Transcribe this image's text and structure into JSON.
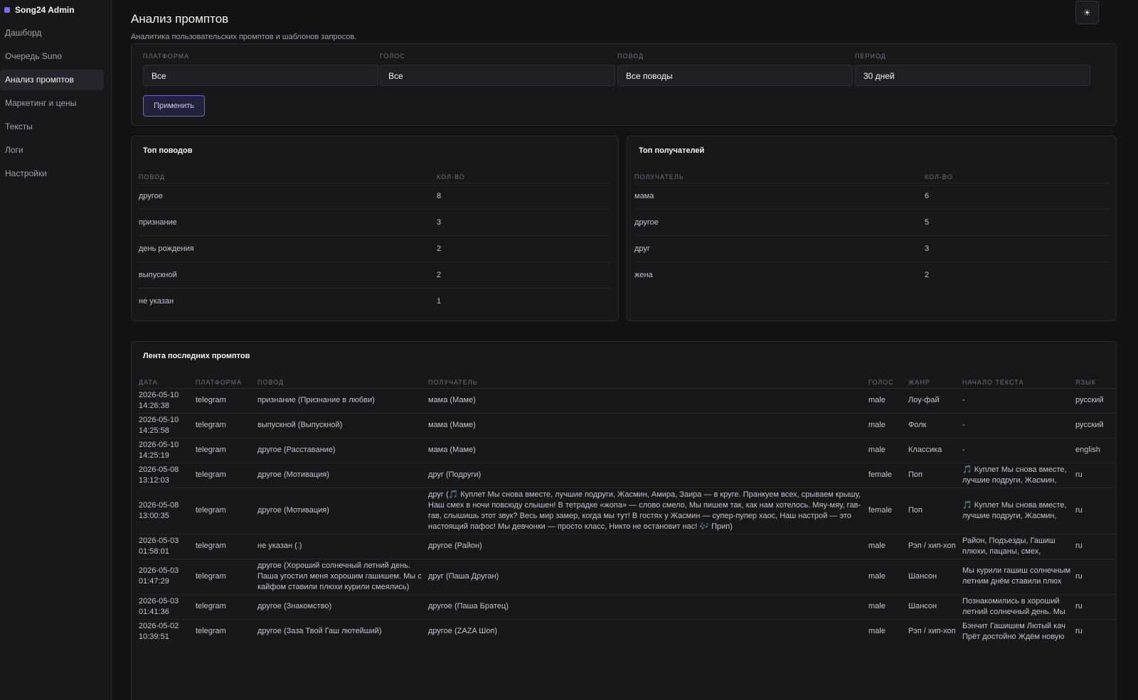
{
  "sidebar": {
    "brand": "Song24 Admin",
    "items": [
      {
        "label": "Дашборд",
        "active": false
      },
      {
        "label": "Очередь Suno",
        "active": false
      },
      {
        "label": "Анализ промптов",
        "active": true
      },
      {
        "label": "Маркетинг и цены",
        "active": false
      },
      {
        "label": "Тексты",
        "active": false
      },
      {
        "label": "Логи",
        "active": false
      },
      {
        "label": "Настройки",
        "active": false
      }
    ]
  },
  "header": {
    "title": "Анализ промптов",
    "subtitle": "Аналитика пользовательских промптов и шаблонов запросов.",
    "theme_icon": "☀"
  },
  "filters": {
    "platform": {
      "label": "Платформа",
      "value": "Все"
    },
    "voice": {
      "label": "Голос",
      "value": "Все"
    },
    "occasion": {
      "label": "Повод",
      "value": "Все поводы"
    },
    "period": {
      "label": "Период",
      "value": "30 дней"
    },
    "apply_label": "Применить"
  },
  "top_occasions": {
    "title": "Топ поводов",
    "headers": [
      "Повод",
      "Кол-во"
    ],
    "rows": [
      [
        "другое",
        "8"
      ],
      [
        "признание",
        "3"
      ],
      [
        "день рождения",
        "2"
      ],
      [
        "выпускной",
        "2"
      ],
      [
        "не указан",
        "1"
      ]
    ]
  },
  "top_recipients": {
    "title": "Топ получателей",
    "headers": [
      "Получатель",
      "Кол-во"
    ],
    "rows": [
      [
        "мама",
        "6"
      ],
      [
        "другое",
        "5"
      ],
      [
        "друг",
        "3"
      ],
      [
        "жена",
        "2"
      ]
    ]
  },
  "feed": {
    "title": "Лента последних промптов",
    "headers": [
      "Дата",
      "Платформа",
      "Повод",
      "Получатель",
      "Голос",
      "Жанр",
      "Начало текста",
      "Язык"
    ],
    "rows": [
      [
        "2026-05-10 14:26:38",
        "telegram",
        "признание (Признание в любви)",
        "мама (Маме)",
        "male",
        "Лоу-фай",
        "-",
        "русский"
      ],
      [
        "2026-05-10 14:25:58",
        "telegram",
        "выпускной (Выпускной)",
        "мама (Маме)",
        "male",
        "Фолк",
        "-",
        "русский"
      ],
      [
        "2026-05-10 14:25:19",
        "telegram",
        "другое (Расставание)",
        "мама (Маме)",
        "male",
        "Классика",
        "-",
        "english"
      ],
      [
        "2026-05-08 13:12:03",
        "telegram",
        "другое (Мотивация)",
        "друг (Подруги)",
        "female",
        "Поп",
        "🎵 Куплет Мы снова вместе, лучшие подруги, Жасмин,",
        "ru"
      ],
      [
        "2026-05-08 13:00:35",
        "telegram",
        "другое (Мотивация)",
        "друг (🎵 Куплет Мы снова вместе, лучшие подруги, Жасмин, Амира, Заира — в круге. Пранкуем всех, срываем крышу, Наш смех в ночи повсюду слышен! В тетрадке «жопа» — слово смело, Мы пишем так, как нам хотелось. Мяу-мяу, гав-гав, слышишь этот звук? Весь мир замер, когда мы тут! В гостях у Жасмин — супер-пупер хаос, Наш настрой — это настоящий пафос! Мы девчонки — просто класс, Никто не остановит нас! 🎶 Прип)",
        "female",
        "Поп",
        "🎵 Куплет Мы снова вместе, лучшие подруги, Жасмин,",
        "ru"
      ],
      [
        "2026-05-03 01:58:01",
        "telegram",
        "не указан (.)",
        "другое (Район)",
        "male",
        "Рэп / хип-хоп",
        "Район, Подъезды, Гашиш плюхи, пацаны, смех,",
        "ru"
      ],
      [
        "2026-05-03 01:47:29",
        "telegram",
        "другое (Хороший солнечный летний день. Паша угостил меня хорошим гашишем. Мы с кайфом ставили плюхи курили смеялись)",
        "друг (Паша Друган)",
        "male",
        "Шансон",
        "Мы курили гашиш солнечным летним днём ставили плюх",
        "ru"
      ],
      [
        "2026-05-03 01:41:36",
        "telegram",
        "другое (Знакомство)",
        "другое (Паша Братец)",
        "male",
        "Шансон",
        "Познакомились в хороший летний солнечный день. Мы",
        "ru"
      ],
      [
        "2026-05-02 10:39:51",
        "telegram",
        "другое (Заза Твой Гаш лютейший)",
        "другое (ZAZA Шоп)",
        "male",
        "Рэп / хип-хоп",
        "Бэнчит Гашишем Лютый кач Прёт достойно Ждём новую",
        "ru"
      ]
    ]
  }
}
